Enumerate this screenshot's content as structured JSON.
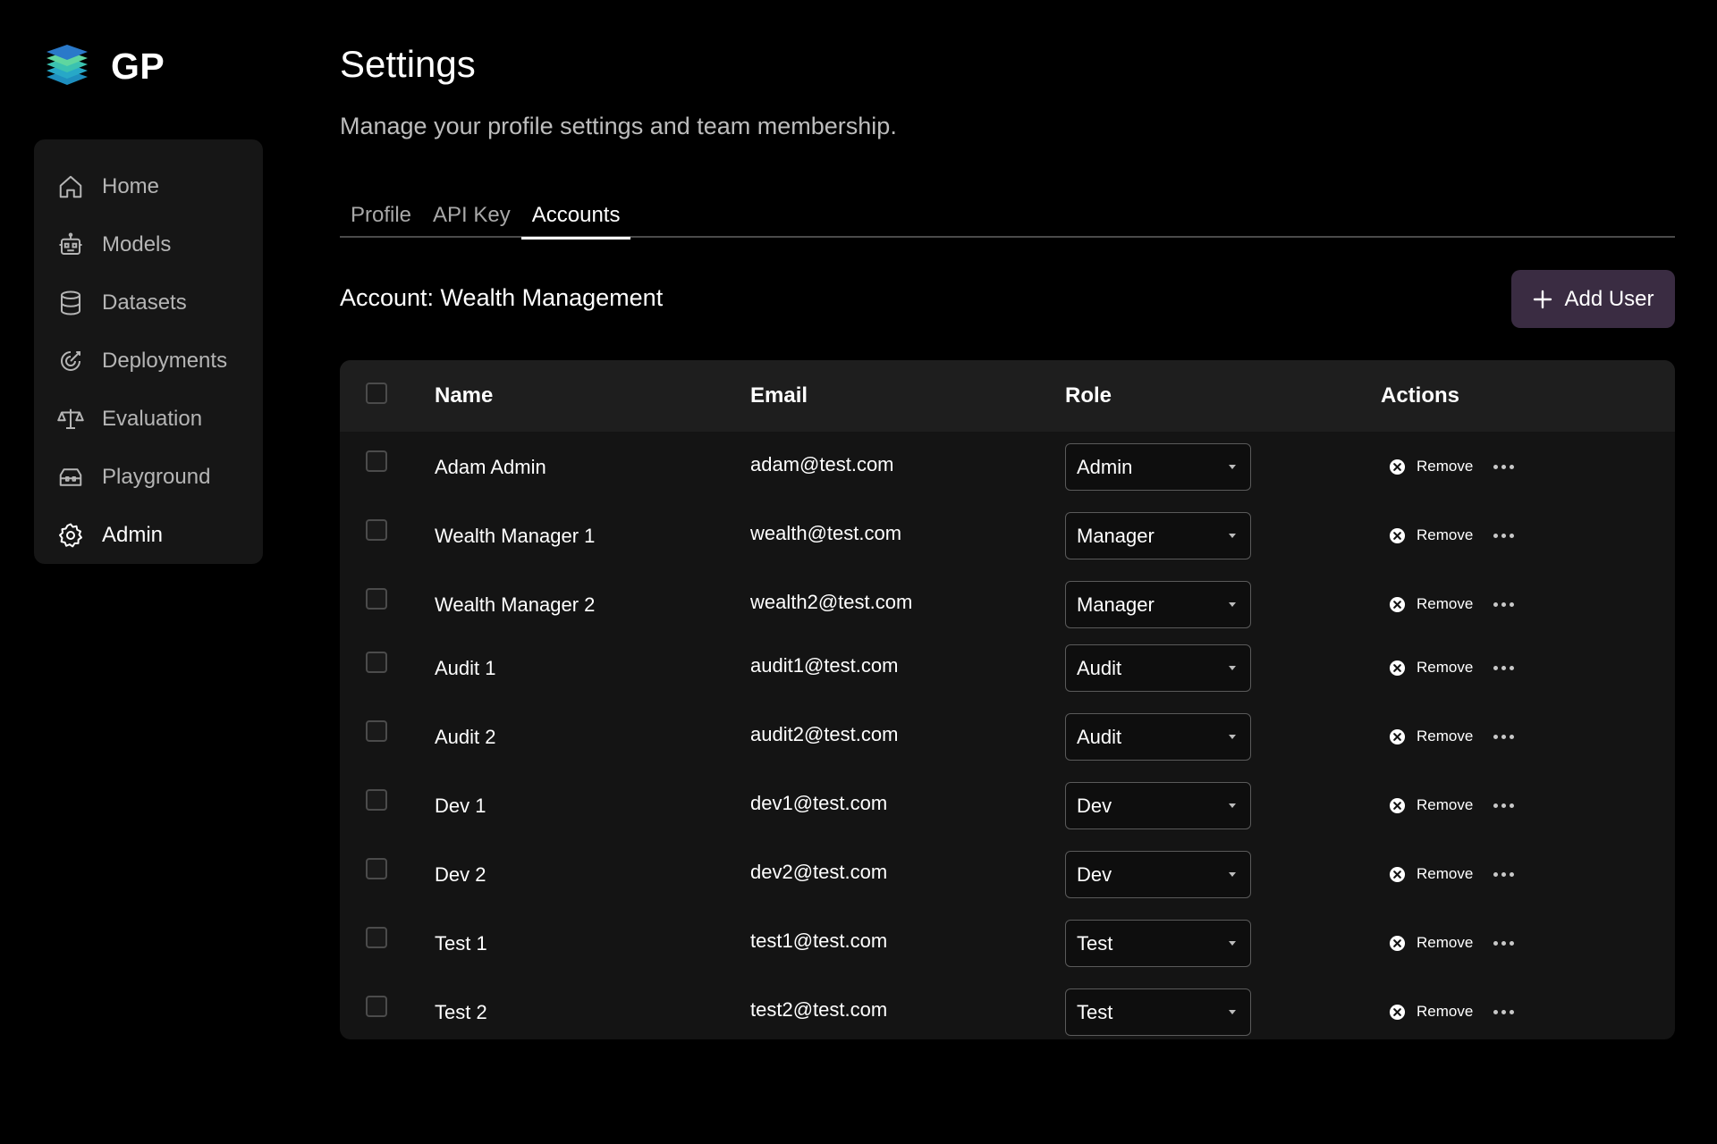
{
  "brand": {
    "name": "GP"
  },
  "sidebar": {
    "items": [
      {
        "label": "Home",
        "icon": "home-icon",
        "active": false
      },
      {
        "label": "Models",
        "icon": "robot-icon",
        "active": false
      },
      {
        "label": "Datasets",
        "icon": "database-icon",
        "active": false
      },
      {
        "label": "Deployments",
        "icon": "target-icon",
        "active": false
      },
      {
        "label": "Evaluation",
        "icon": "scale-icon",
        "active": false
      },
      {
        "label": "Playground",
        "icon": "toolbox-icon",
        "active": false
      },
      {
        "label": "Admin",
        "icon": "gear-icon",
        "active": true
      }
    ]
  },
  "header": {
    "title": "Settings",
    "subtitle": "Manage your profile settings and team membership."
  },
  "tabs": [
    {
      "label": "Profile",
      "active": false
    },
    {
      "label": "API Key",
      "active": false
    },
    {
      "label": "Accounts",
      "active": true
    }
  ],
  "account": {
    "title": "Account: Wealth Management",
    "add_user_label": "Add User"
  },
  "table": {
    "columns": {
      "name": "Name",
      "email": "Email",
      "role": "Role",
      "actions": "Actions"
    },
    "remove_label": "Remove",
    "rows": [
      {
        "name": "Adam Admin",
        "email": "adam@test.com",
        "role": "Admin"
      },
      {
        "name": "Wealth Manager 1",
        "email": "wealth@test.com",
        "role": "Manager"
      },
      {
        "name": "Wealth Manager 2",
        "email": "wealth2@test.com",
        "role": "Manager"
      },
      {
        "name": "Audit 1",
        "email": "audit1@test.com",
        "role": "Audit"
      },
      {
        "name": "Audit 2",
        "email": "audit2@test.com",
        "role": "Audit"
      },
      {
        "name": "Dev 1",
        "email": "dev1@test.com",
        "role": "Dev"
      },
      {
        "name": "Dev 2",
        "email": "dev2@test.com",
        "role": "Dev"
      },
      {
        "name": "Test 1",
        "email": "test1@test.com",
        "role": "Test"
      },
      {
        "name": "Test 2",
        "email": "test2@test.com",
        "role": "Test"
      }
    ]
  },
  "colors": {
    "background": "#000000",
    "sidebar": "#161616",
    "table_body": "#141414",
    "table_header": "#1e1e1e",
    "add_user_button": "#3a2c42"
  }
}
